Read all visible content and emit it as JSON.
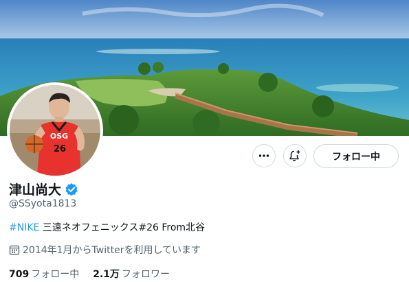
{
  "profile": {
    "display_name": "津山尚大",
    "handle": "@SSyota1813",
    "bio": {
      "hashtag": "#NIKE",
      "text": " 三遠ネオフェニックス#26 From北谷"
    },
    "joined": "2014年1月からTwitterを利用しています",
    "following": {
      "count": "709",
      "label": "フォロー中"
    },
    "followers": {
      "count": "2.1万",
      "label": "フォロワー"
    }
  },
  "actions": {
    "follow_label": "フォロー中"
  },
  "icons": {
    "more": "more-icon",
    "notify": "bell-plus-icon",
    "verified": "verified-badge-icon",
    "calendar": "calendar-icon"
  },
  "colors": {
    "accent": "#1d9bf0",
    "muted_text": "#536471",
    "jersey": "#e8322d"
  },
  "avatar": {
    "jersey_text": "OSG",
    "jersey_number": "26"
  }
}
